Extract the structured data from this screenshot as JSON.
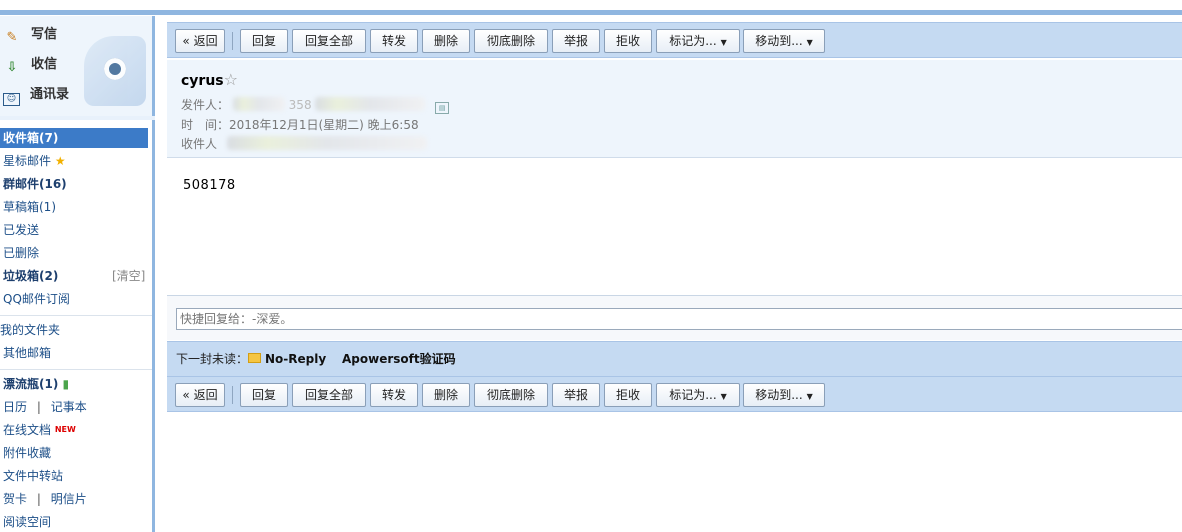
{
  "sidebar": {
    "quick": [
      {
        "label": "写信",
        "icon": "pencil-icon"
      },
      {
        "label": "收信",
        "icon": "inbox-download-icon"
      },
      {
        "label": "通讯录",
        "icon": "contacts-card-icon"
      }
    ],
    "folders": {
      "inbox": "收件箱(7)",
      "starred": "星标邮件",
      "group": "群邮件(16)",
      "drafts": "草稿箱(1)",
      "sent": "已发送",
      "deleted": "已删除",
      "spam": "垃圾箱(2)",
      "spam_clear": "[清空]",
      "subscriptions": "QQ邮件订阅",
      "my_folders": "我的文件夹",
      "other_mailboxes": "其他邮箱",
      "drift_bottle": "漂流瓶(1)",
      "calendar": "日历",
      "notes": "记事本",
      "online_docs": "在线文档",
      "new_badge": "NEW",
      "attachments": "附件收藏",
      "file_transfer": "文件中转站",
      "greeting_card": "贺卡",
      "postcard": "明信片",
      "reading": "阅读空间",
      "divider": "|"
    }
  },
  "toolbar": {
    "back": "« 返回",
    "reply": "回复",
    "reply_all": "回复全部",
    "forward": "转发",
    "delete": "删除",
    "delete_permanent": "彻底删除",
    "report": "举报",
    "reject": "拒收",
    "mark_as": "标记为...",
    "move_to": "移动到...",
    "dropdown_arrow": "▼"
  },
  "message": {
    "subject": "cyrus",
    "star": "☆",
    "sender_label": "发件人：",
    "sender_partial": "358",
    "time_label": "时　间：",
    "time_value": "2018年12月1日(星期二) 晚上6:58",
    "recipient_label": "收件人",
    "body": "508178"
  },
  "quick_reply": {
    "placeholder": "快捷回复给：-深爱。"
  },
  "next_unread": {
    "label": "下一封未读：",
    "from": "No-Reply",
    "subject": "Apowersoft验证码"
  }
}
